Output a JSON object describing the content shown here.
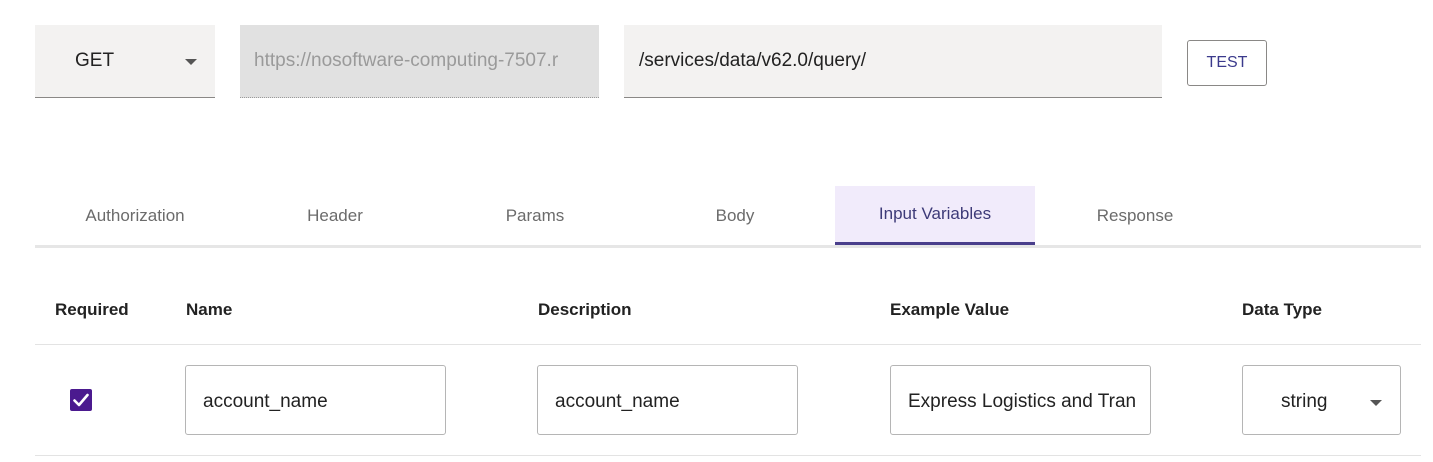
{
  "request": {
    "method": "GET",
    "base_url": "https://nosoftware-computing-7507.r",
    "path": "/services/data/v62.0/query/",
    "test_label": "TEST"
  },
  "tabs": [
    {
      "label": "Authorization"
    },
    {
      "label": "Header"
    },
    {
      "label": "Params"
    },
    {
      "label": "Body"
    },
    {
      "label": "Input Variables",
      "active": true
    },
    {
      "label": "Response"
    }
  ],
  "table": {
    "columns": [
      "Required",
      "Name",
      "Description",
      "Example Value",
      "Data Type"
    ],
    "rows": [
      {
        "required": true,
        "name": "account_name",
        "description": "account_name",
        "example_value": "Express Logistics and Tran",
        "data_type": "string"
      }
    ]
  },
  "colors": {
    "accent": "#4b1a8f",
    "active_tab_bg": "#f1ebfb",
    "active_tab_text": "#3d3a78"
  },
  "icons": {
    "dropdown": "chevron-down-icon",
    "checkbox": "checkmark-icon"
  }
}
